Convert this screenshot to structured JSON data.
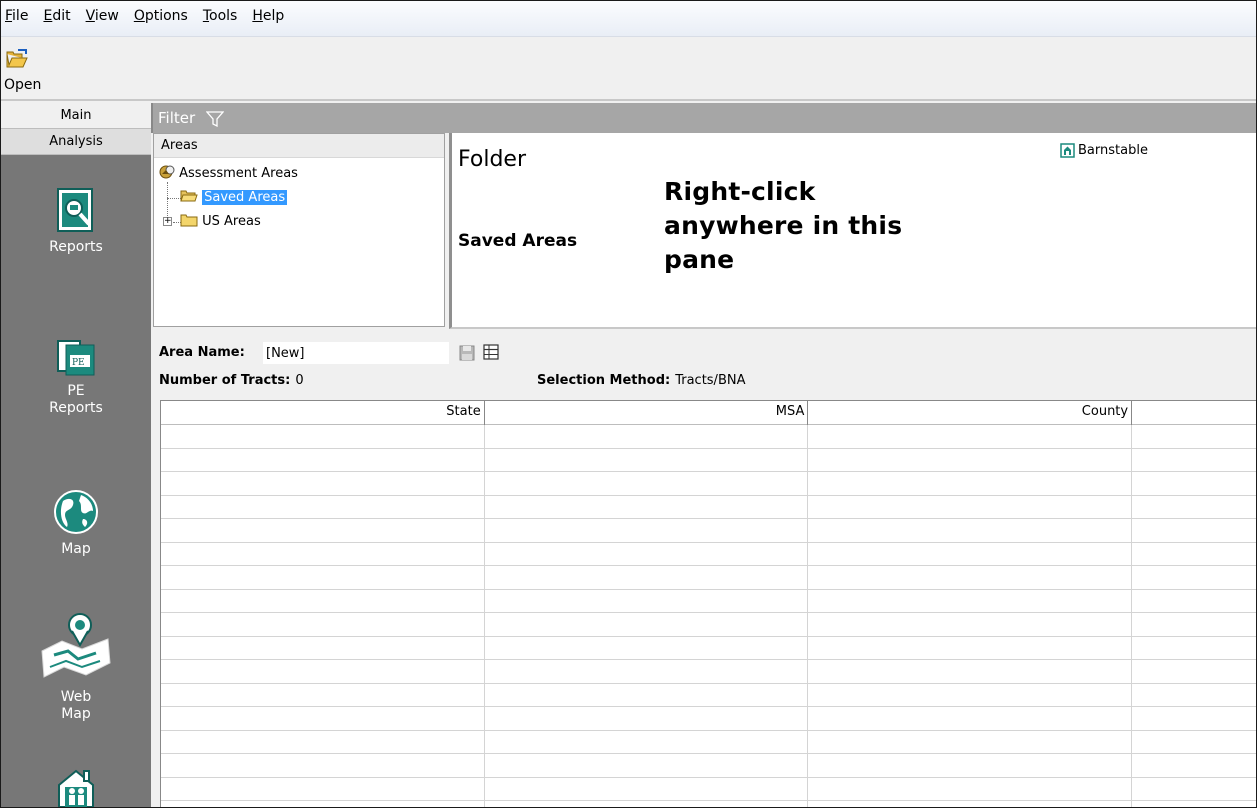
{
  "menu": [
    {
      "acc": "F",
      "rest": "ile"
    },
    {
      "acc": "E",
      "rest": "dit"
    },
    {
      "acc": "V",
      "rest": "iew"
    },
    {
      "acc": "O",
      "rest": "ptions"
    },
    {
      "acc": "T",
      "rest": "ools"
    },
    {
      "acc": "H",
      "rest": "elp"
    }
  ],
  "toolbar": {
    "open_label": "Open"
  },
  "nav": {
    "tab_main": "Main",
    "tab_analysis": "Analysis",
    "reports": "Reports",
    "pe_line1": "PE",
    "pe_line2": "Reports",
    "map": "Map",
    "web_line1": "Web",
    "web_line2": "Map"
  },
  "filter": {
    "label": "Filter"
  },
  "areas": {
    "header": "Areas",
    "root": "Assessment Areas",
    "saved": "Saved Areas",
    "us": "US Areas"
  },
  "folder": {
    "title": "Folder",
    "subtitle": "Saved Areas",
    "location": "Barnstable",
    "callout_line1": "Right-click",
    "callout_line2": "anywhere in this",
    "callout_line3": "pane"
  },
  "details": {
    "area_name_label": "Area Name:",
    "area_name_value": "[New]",
    "tracts_label": "Number of Tracts:",
    "tracts_value": "0",
    "method_label": "Selection Method:",
    "method_value": "Tracts/BNA"
  },
  "table": {
    "columns": [
      "State",
      "MSA",
      "County",
      ""
    ]
  }
}
